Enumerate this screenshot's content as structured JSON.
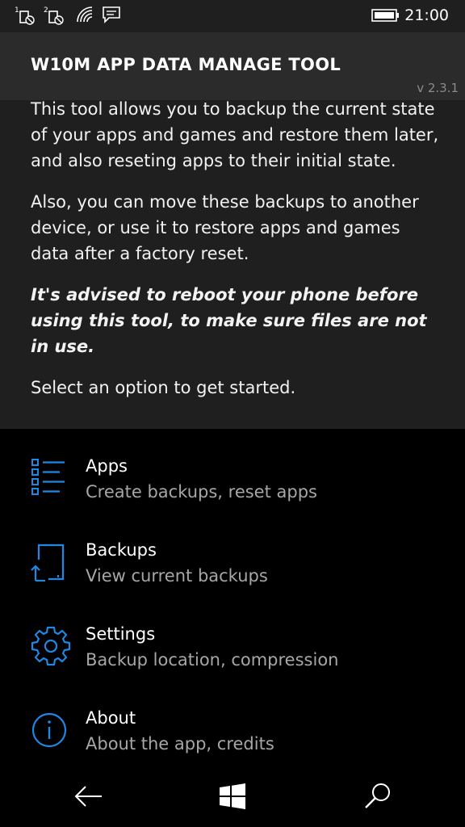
{
  "statusbar": {
    "time": "21:00",
    "sim1_label": "1",
    "sim2_label": "2",
    "icons": [
      "sim1-no-signal-icon",
      "sim2-no-signal-icon",
      "wifi-icon",
      "message-icon",
      "battery-icon"
    ]
  },
  "header": {
    "title": "W10M APP DATA MANAGE TOOL",
    "version": "v 2.3.1"
  },
  "description": {
    "paragraph1": "This tool allows you to backup the current state of your apps and games and restore them later, and also reseting apps to their initial state.",
    "paragraph2": "Also, you can move these backups to another device, or use it to restore apps and games data after a factory reset.",
    "warning": "It's advised to reboot your phone before using this tool, to make sure files are not in use.",
    "prompt": "Select an option to get started."
  },
  "menu": [
    {
      "title": "Apps",
      "subtitle": "Create backups, reset apps",
      "icon": "list-icon"
    },
    {
      "title": "Backups",
      "subtitle": "View current backups",
      "icon": "backup-tablet-icon"
    },
    {
      "title": "Settings",
      "subtitle": "Backup location, compression",
      "icon": "gear-icon"
    },
    {
      "title": "About",
      "subtitle": "About the app, credits",
      "icon": "info-icon"
    }
  ],
  "navbar": {
    "icons": [
      "back-arrow-icon",
      "windows-start-icon",
      "search-icon"
    ]
  },
  "colors": {
    "accent": "#1e88e5",
    "header_bg": "#1f1f1f",
    "title_bg": "#2b2b2b",
    "body_bg": "#000000",
    "subtitle": "#a6a6a6"
  }
}
